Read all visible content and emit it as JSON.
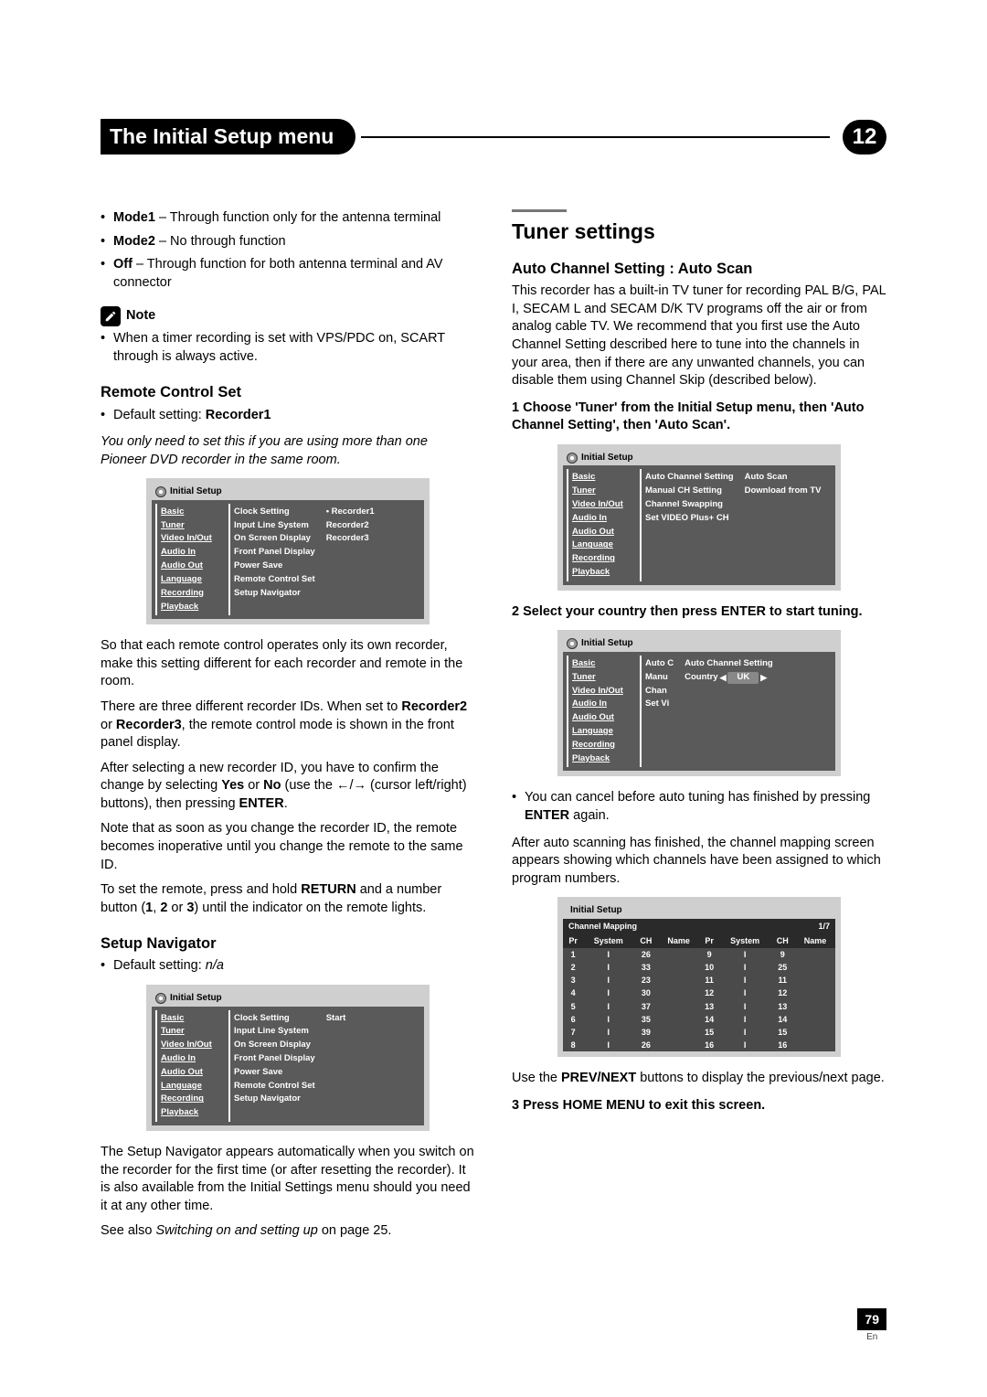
{
  "header": {
    "title": "The Initial Setup menu",
    "chapter": "12"
  },
  "left": {
    "modes": [
      {
        "name": "Mode1",
        "desc": " – Through function only for the antenna terminal"
      },
      {
        "name": "Mode2",
        "desc": " – No through function"
      },
      {
        "name": "Off",
        "desc": " – Through function for both antenna terminal and AV connector"
      }
    ],
    "noteLabel": "Note",
    "noteText": "When a timer recording is set with VPS/PDC on, SCART through is always active.",
    "remote": {
      "heading": "Remote Control Set",
      "default": "Default setting: ",
      "defaultVal": "Recorder1",
      "intro": "You only need to set this if you are using more than one Pioneer DVD recorder in the same room.",
      "p1a": "So that each remote control operates only its own recorder, make this setting different for each recorder and remote in the room.",
      "p2a": "There are three different recorder IDs. When set to ",
      "p2b": "Recorder2",
      "p2c": " or ",
      "p2d": "Recorder3",
      "p2e": ", the remote control mode is shown in the front panel display.",
      "p3a": "After selecting a new recorder ID, you have to confirm the change by selecting ",
      "p3b": "Yes",
      "p3c": " or ",
      "p3d": "No",
      "p3e": " (use the ",
      "p3f": " (cursor left/right) buttons), then pressing ",
      "p3g": "ENTER",
      "p3h": ".",
      "p4": "Note that as soon as you change the recorder ID, the remote becomes inoperative until you change the remote to the same ID.",
      "p5a": "To set the remote, press and hold ",
      "p5b": "RETURN",
      "p5c": " and a number button (",
      "p5d": "1",
      "p5e": ", ",
      "p5f": "2",
      "p5g": " or ",
      "p5h": "3",
      "p5i": ") until the indicator on the remote lights."
    },
    "setupNav": {
      "heading": "Setup Navigator",
      "default": "Default setting: ",
      "defaultVal": "n/a",
      "p1": "The Setup Navigator appears automatically when you switch on the recorder for the first time (or after resetting the recorder). It is also available from the Initial Settings menu should you need it at any other time.",
      "p2a": "See also ",
      "p2b": "Switching on and setting up",
      "p2c": " on page 25."
    },
    "menu1": {
      "title": "Initial Setup",
      "left": [
        "Basic",
        "Tuner",
        "Video In/Out",
        "Audio In",
        "Audio Out",
        "Language",
        "Recording",
        "Playback"
      ],
      "mid": [
        "Clock Setting",
        "Input Line System",
        "On Screen Display",
        "Front Panel Display",
        "Power Save",
        "Remote Control Set",
        "Setup Navigator"
      ],
      "right": [
        "Recorder1",
        "Recorder2",
        "Recorder3"
      ]
    },
    "menu2": {
      "title": "Initial Setup",
      "left": [
        "Basic",
        "Tuner",
        "Video In/Out",
        "Audio In",
        "Audio Out",
        "Language",
        "Recording",
        "Playback"
      ],
      "mid": [
        "Clock Setting",
        "Input Line System",
        "On Screen Display",
        "Front Panel Display",
        "Power Save",
        "Remote Control Set",
        "Setup Navigator"
      ],
      "right": [
        "Start"
      ]
    }
  },
  "right": {
    "heading": "Tuner settings",
    "sub1": "Auto Channel Setting : Auto Scan",
    "intro": "This recorder has a built-in TV tuner for recording PAL B/G, PAL I, SECAM L and SECAM D/K TV programs off the air or from analog cable TV. We recommend that you first use the Auto Channel Setting described here to tune into the channels in your area, then if there are any unwanted channels, you can disable them using Channel Skip (described below).",
    "step1": "1    Choose 'Tuner' from the Initial Setup menu, then 'Auto Channel Setting', then 'Auto Scan'.",
    "menu3": {
      "title": "Initial Setup",
      "left": [
        "Basic",
        "Tuner",
        "Video In/Out",
        "Audio In",
        "Audio Out",
        "Language",
        "Recording",
        "Playback"
      ],
      "mid": [
        "Auto Channel Setting",
        "Manual CH Setting",
        "Channel Swapping",
        "Set VIDEO Plus+ CH"
      ],
      "right": [
        "Auto Scan",
        "Download from TV"
      ]
    },
    "step2": "2    Select your country then press ENTER to start tuning.",
    "menu4": {
      "title": "Initial Setup",
      "left": [
        "Basic",
        "Tuner",
        "Video In/Out",
        "Audio In",
        "Audio Out",
        "Language",
        "Recording",
        "Playback"
      ],
      "midpre": [
        "Auto C",
        "Manu",
        "Chan",
        "Set Vi"
      ],
      "popTitle": "Auto Channel Setting",
      "countryLabel": "Country",
      "countryVal": "UK"
    },
    "cancelA": "You can cancel before auto tuning has finished by pressing ",
    "cancelB": "ENTER",
    "cancelC": " again.",
    "afterScan": "After auto scanning has finished, the channel mapping screen appears showing which channels have been assigned to which program numbers.",
    "mapping": {
      "title": "Initial Setup",
      "cap": "Channel Mapping",
      "page": "1/7",
      "cols": [
        "Pr",
        "System",
        "CH",
        "Name",
        "Pr",
        "System",
        "CH",
        "Name"
      ],
      "rows": [
        [
          "1",
          "I",
          "26",
          "",
          "9",
          "I",
          "9",
          ""
        ],
        [
          "2",
          "I",
          "33",
          "",
          "10",
          "I",
          "25",
          ""
        ],
        [
          "3",
          "I",
          "23",
          "",
          "11",
          "I",
          "11",
          ""
        ],
        [
          "4",
          "I",
          "30",
          "",
          "12",
          "I",
          "12",
          ""
        ],
        [
          "5",
          "I",
          "37",
          "",
          "13",
          "I",
          "13",
          ""
        ],
        [
          "6",
          "I",
          "35",
          "",
          "14",
          "I",
          "14",
          ""
        ],
        [
          "7",
          "I",
          "39",
          "",
          "15",
          "I",
          "15",
          ""
        ],
        [
          "8",
          "I",
          "26",
          "",
          "16",
          "I",
          "16",
          ""
        ]
      ]
    },
    "useA": "Use the ",
    "useB": "PREV/NEXT",
    "useC": " buttons to display the previous/next page.",
    "step3": "3    Press HOME MENU to exit this screen."
  },
  "footer": {
    "page": "79",
    "lang": "En"
  }
}
